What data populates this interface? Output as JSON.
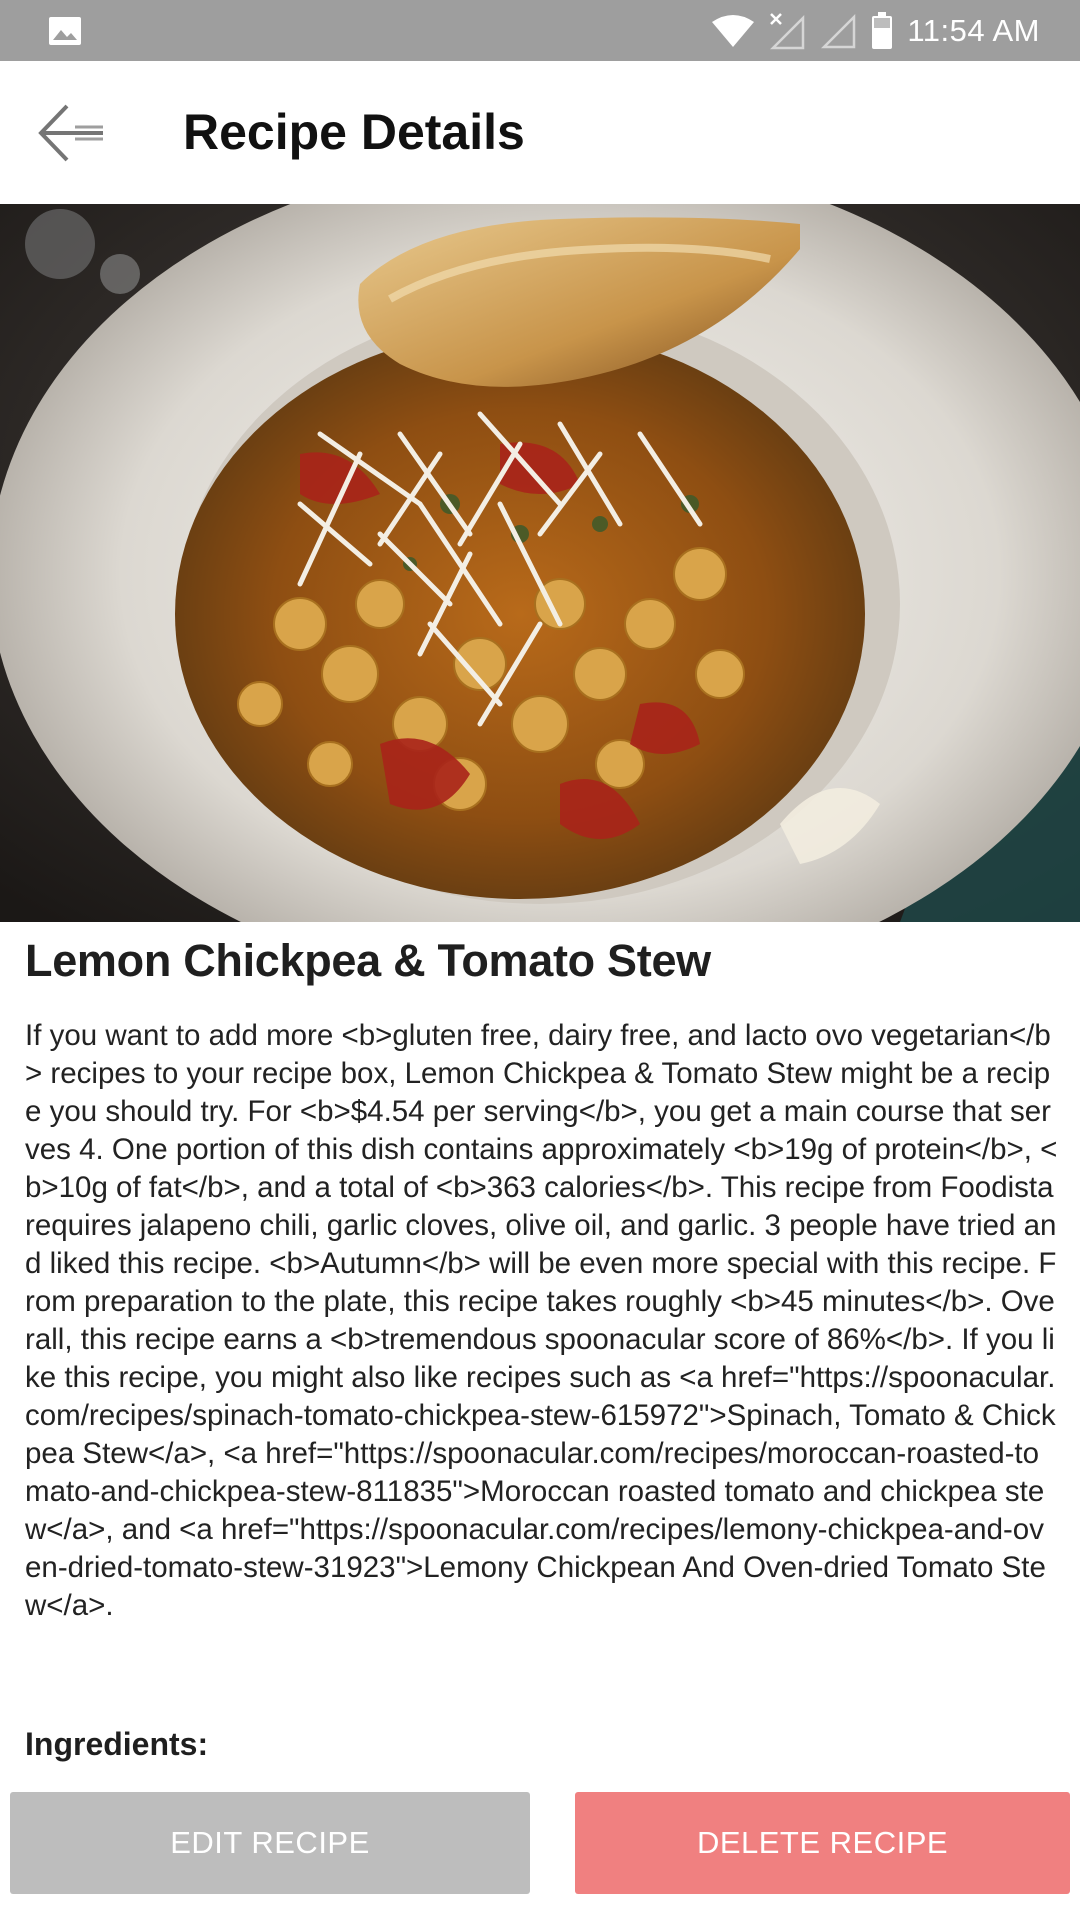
{
  "status_bar": {
    "time": "11:54 AM",
    "icons": [
      "image-icon",
      "wifi-icon",
      "signal-off-icon",
      "signal-icon",
      "battery-icon"
    ]
  },
  "app_bar": {
    "title": "Recipe Details",
    "back_icon": "arrow-left-icon"
  },
  "recipe": {
    "image_description": "Bowl of lemon chickpea and tomato stew with grated cheese and toasted bread",
    "title": "Lemon Chickpea & Tomato Stew",
    "summary": "If you want to add more <b>gluten free, dairy free, and lacto ovo vegetarian</b> recipes to your recipe box, Lemon Chickpea & Tomato Stew might be a recipe you should try. For <b>$4.54 per serving</b>, you get a main course that serves 4. One portion of this dish contains approximately <b>19g of protein</b>, <b>10g of fat</b>, and a total of <b>363 calories</b>. This recipe from Foodista requires jalapeno chili, garlic cloves, olive oil, and garlic. 3 people have tried and liked this recipe. <b>Autumn</b> will be even more special with this recipe. From preparation to the plate, this recipe takes roughly <b>45 minutes</b>. Overall, this recipe earns a <b>tremendous spoonacular score of 86%</b>. If you like this recipe, you might also like recipes such as <a href=\"https://spoonacular.com/recipes/spinach-tomato-chickpea-stew-615972\">Spinach, Tomato & Chickpea Stew</a>, <a href=\"https://spoonacular.com/recipes/moroccan-roasted-tomato-and-chickpea-stew-811835\">Moroccan roasted tomato and chickpea stew</a>, and <a href=\"https://spoonacular.com/recipes/lemony-chickpea-and-oven-dried-tomato-stew-31923\">Lemony Chickpean And Oven-dried Tomato Stew</a>.",
    "ingredients_heading": "Ingredients:"
  },
  "actions": {
    "edit_label": "EDIT RECIPE",
    "delete_label": "DELETE RECIPE",
    "edit_color": "#bdbdbd",
    "delete_color": "#f08080"
  }
}
